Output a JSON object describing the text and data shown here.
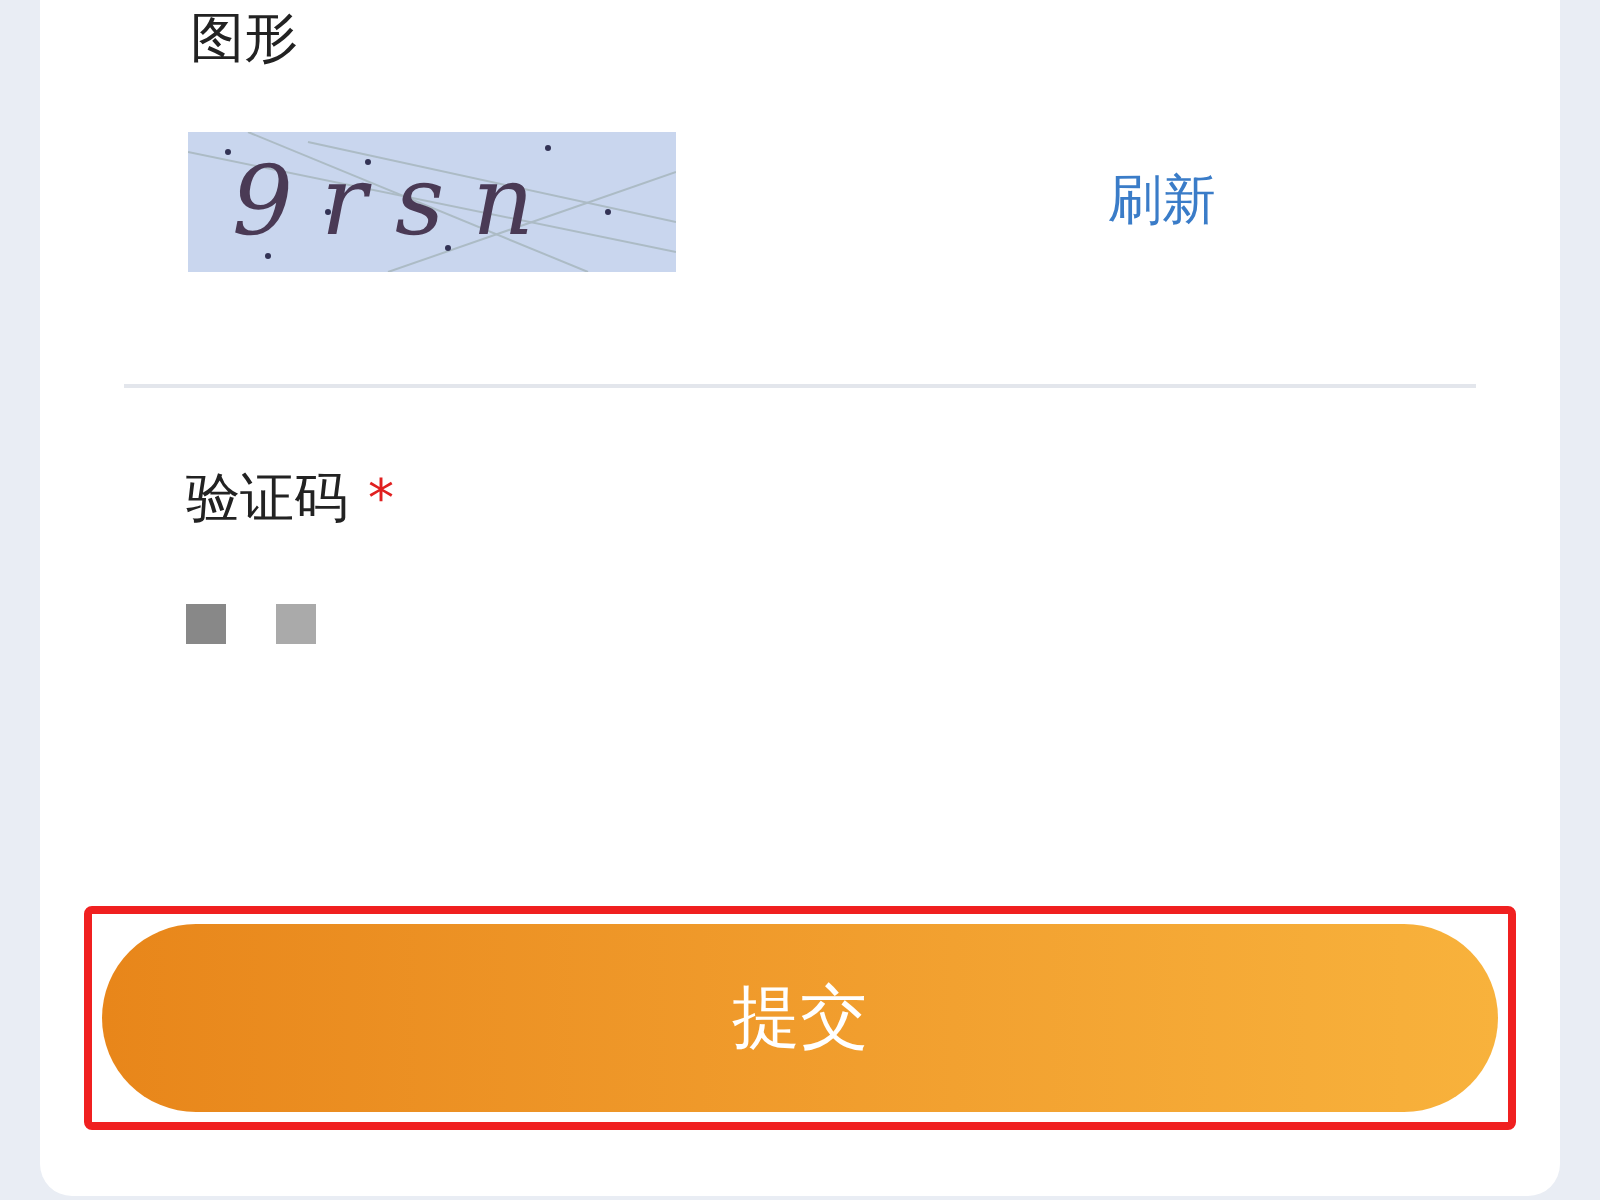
{
  "captcha": {
    "label": "图形",
    "code": "9rsn",
    "refresh": "刷新"
  },
  "verification": {
    "label": "验证码",
    "required_mark": "*",
    "masked_value": true
  },
  "submit": {
    "label": "提交",
    "highlighted": true
  }
}
